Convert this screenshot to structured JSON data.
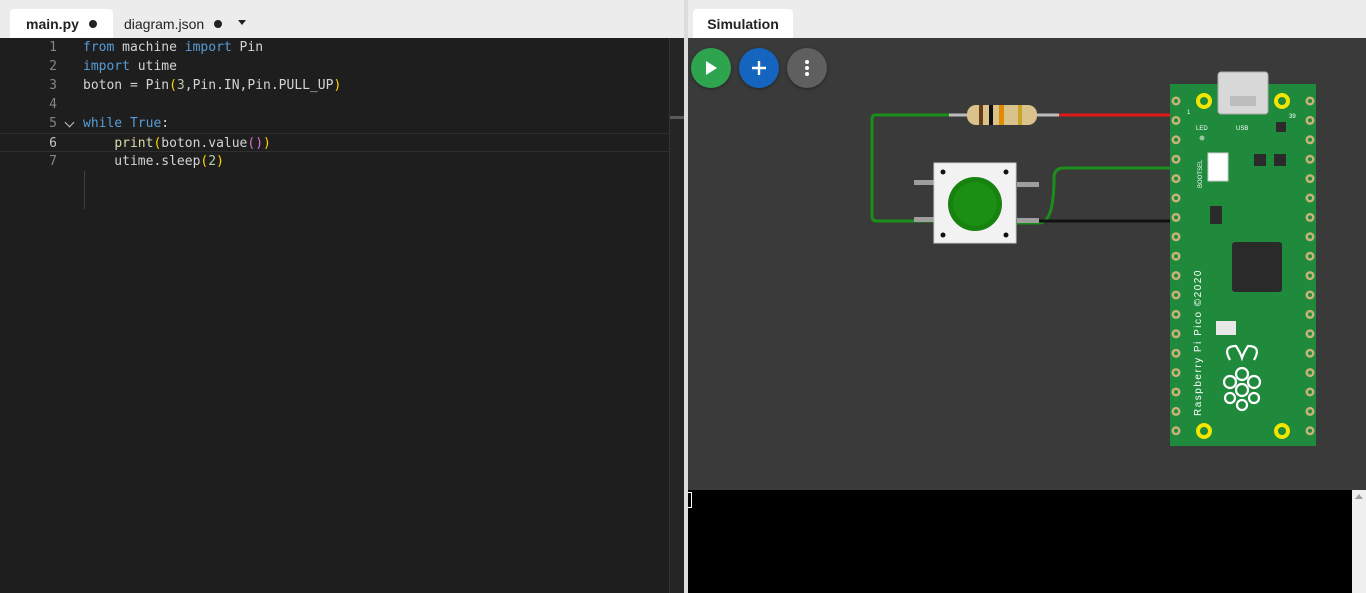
{
  "editor": {
    "tabs": [
      {
        "label": "main.py",
        "active": true,
        "unsaved": true
      },
      {
        "label": "diagram.json",
        "active": false,
        "unsaved": true
      }
    ],
    "current_line": 6,
    "lines": [
      {
        "number": "1",
        "text": "from machine import Pin"
      },
      {
        "number": "2",
        "text": "import utime"
      },
      {
        "number": "3",
        "text": "boton = Pin(3,Pin.IN,Pin.PULL_UP)"
      },
      {
        "number": "4",
        "text": ""
      },
      {
        "number": "5",
        "text": "while True:"
      },
      {
        "number": "6",
        "text": "    print(boton.value())"
      },
      {
        "number": "7",
        "text": "    utime.sleep(2)"
      }
    ]
  },
  "simulation": {
    "tab_label": "Simulation",
    "toolbar": {
      "run_icon": "play-icon",
      "add_icon": "plus-icon",
      "more_icon": "more-vertical-icon"
    },
    "board": {
      "name_text": "Raspberry Pi Pico ©2020",
      "led_label": "LED",
      "usb_label": "USB",
      "bootsel_label": "BOOTSEL",
      "pin_label_1": "1",
      "pin_label_39": "39"
    },
    "components": [
      "resistor",
      "pushbutton",
      "raspberry-pi-pico"
    ],
    "wire_colors": {
      "green": "#1a8f1a",
      "red": "#e01818",
      "black": "#111111"
    }
  },
  "colors": {
    "run": "#2ea44f",
    "add": "#1565c0",
    "more": "#5f5f5f",
    "board": "#1f8a3c",
    "canvas": "#3a3a3a"
  }
}
